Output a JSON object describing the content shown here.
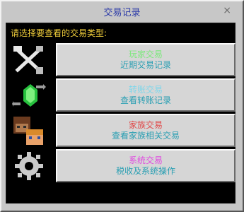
{
  "window": {
    "title": "交易记录",
    "close": "×"
  },
  "prompt": "请选择要查看的交易类型:",
  "options": [
    {
      "title": "玩家交易",
      "subtitle": "近期交易记录",
      "title_color": "#7ee87e",
      "icon": "wrench-icon"
    },
    {
      "title": "转账交易",
      "subtitle": "查看转账记录",
      "title_color": "#7fd7ea",
      "icon": "emerald-icon"
    },
    {
      "title": "家族交易",
      "subtitle": "查看家族相关交易",
      "title_color": "#e04a4a",
      "icon": "family-heads-icon"
    },
    {
      "title": "系统交易",
      "subtitle": "税收及系统操作",
      "title_color": "#e04ae0",
      "icon": "gear-icon"
    }
  ],
  "colors": {
    "prompt": "#f3d03b",
    "title": "#2b3aa8",
    "subtitle": "#2a9fb3"
  }
}
